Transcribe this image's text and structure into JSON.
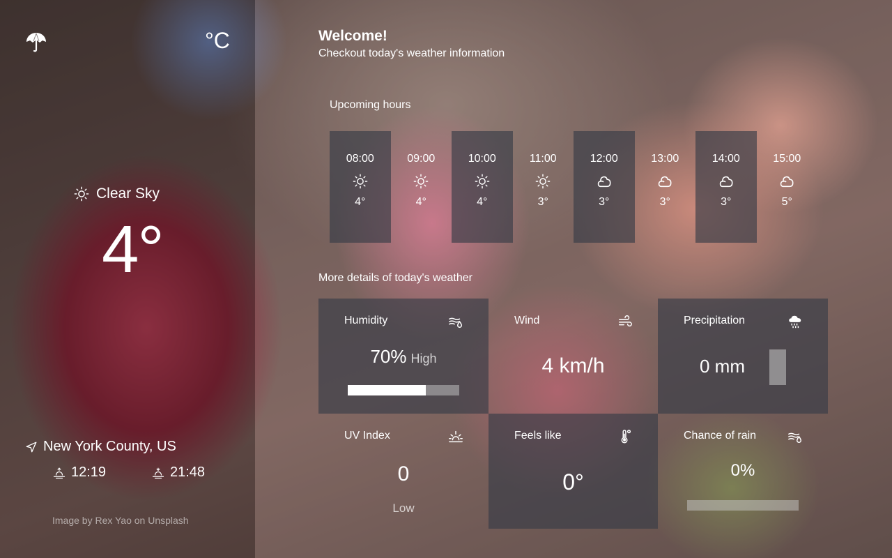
{
  "left": {
    "unit_toggle": "°C",
    "condition": "Clear Sky",
    "temperature": "4°",
    "location": "New York County, US",
    "sunrise": "12:19",
    "sunset": "21:48",
    "credit": "Image by Rex Yao on Unsplash"
  },
  "header": {
    "title": "Welcome!",
    "subtitle": "Checkout today's weather information"
  },
  "upcoming": {
    "label": "Upcoming hours",
    "hours": [
      {
        "time": "08:00",
        "icon": "sun-icon",
        "temp": "4°"
      },
      {
        "time": "09:00",
        "icon": "sun-icon",
        "temp": "4°"
      },
      {
        "time": "10:00",
        "icon": "sun-icon",
        "temp": "4°"
      },
      {
        "time": "11:00",
        "icon": "sun-icon",
        "temp": "3°"
      },
      {
        "time": "12:00",
        "icon": "cloud-icon",
        "temp": "3°"
      },
      {
        "time": "13:00",
        "icon": "cloud-icon",
        "temp": "3°"
      },
      {
        "time": "14:00",
        "icon": "cloud-icon",
        "temp": "3°"
      },
      {
        "time": "15:00",
        "icon": "cloud-icon",
        "temp": "5°"
      }
    ]
  },
  "details": {
    "label": "More details of today's weather",
    "humidity": {
      "name": "Humidity",
      "value": "70%",
      "level": "High",
      "fraction": 0.7
    },
    "wind": {
      "name": "Wind",
      "value": "4 km/h"
    },
    "precipitation": {
      "name": "Precipitation",
      "value": "0 mm",
      "fraction": 0
    },
    "uv": {
      "name": "UV Index",
      "value": "0",
      "level": "Low"
    },
    "feels_like": {
      "name": "Feels like",
      "value": "0°"
    },
    "chance_of_rain": {
      "name": "Chance of rain",
      "value": "0%",
      "fraction": 0
    }
  }
}
